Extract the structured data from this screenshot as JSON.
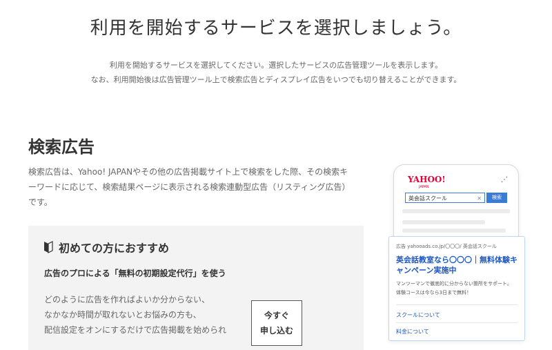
{
  "header": {
    "title": "利用を開始するサービスを選択しましょう。",
    "intro_line1": "利用を開始するサービスを選択してください。選択したサービスの広告管理ツールを表示します。",
    "intro_line2": "なお、利用開始後は広告管理ツール上で検索広告とディスプレイ広告をいつでも切り替えることができます。"
  },
  "search_ads": {
    "title": "検索広告",
    "desc_line1": "検索広告は、Yahoo! JAPANやその他の広告掲載サイト上で検索をした際、その検索キ",
    "desc_line2": "ーワードに応じて、検索結果ページに表示される検索連動型広告（リスティング広告）",
    "desc_line3": "です。"
  },
  "recommend": {
    "title": "初めての方におすすめ",
    "subtitle": "広告のプロによる「無料の初期設定代行」を使う",
    "body_line1": "どのように広告を作ればよいか分からない、",
    "body_line2": "なかなか時間が取れないとお悩みの方も、",
    "body_line3": "配信設定をオンにするだけで広告掲載を始められ",
    "button_line1": "今すぐ",
    "button_line2": "申し込む",
    "icon": "beginner-mark-icon"
  },
  "phone_mock": {
    "logo": "YAHOO!",
    "logo_sub": "JAPAN",
    "search_value": "英会話スクール",
    "search_button": "検索",
    "menu_icon": "menu-icon"
  },
  "ad_sample": {
    "meta": "広告 yahooads.co.jp/〇〇〇/ 英会話スクール",
    "title": "英会話教室なら〇〇〇｜無料体験キャンペーン実施中",
    "desc_line1": "マンツーマンで徹底的に分からない箇所をサポート。",
    "desc_line2": "体験コースは今なら3日まで無料！",
    "link1": "スクールについて",
    "link2": "料金について"
  },
  "colors": {
    "accent": "#1a56c4",
    "yahoo_red": "#e60033",
    "card_bg": "#f3f3f3"
  }
}
